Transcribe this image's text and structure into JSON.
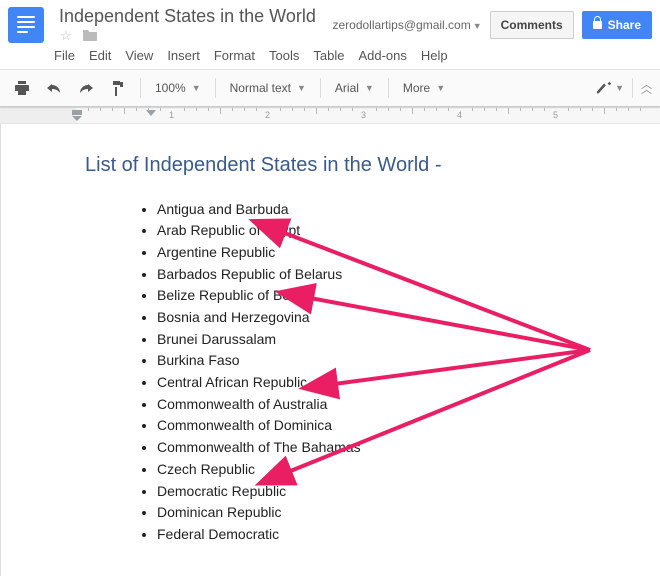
{
  "header": {
    "doc_title": "Independent States in the World",
    "email": "zerodollartips@gmail.com",
    "comments_label": "Comments",
    "share_label": "Share"
  },
  "menu": [
    "File",
    "Edit",
    "View",
    "Insert",
    "Format",
    "Tools",
    "Table",
    "Add-ons",
    "Help"
  ],
  "toolbar": {
    "zoom": "100%",
    "style": "Normal text",
    "font": "Arial",
    "more": "More"
  },
  "document": {
    "heading": "List of Independent States in the World -",
    "items": [
      "Antigua and Barbuda",
      "Arab Republic of Egypt",
      "Argentine Republic",
      "Barbados Republic of Belarus",
      "Belize Republic of Benin",
      "Bosnia and Herzegovina",
      "Brunei Darussalam",
      "Burkina Faso",
      "Central African Republic",
      "Commonwealth of Australia",
      "Commonwealth of Dominica",
      "Commonwealth of The Bahamas",
      "Czech Republic",
      "Democratic Republic",
      "Dominican Republic",
      "Federal Democratic"
    ]
  },
  "ruler_marks": [
    "1",
    "2",
    "3",
    "4",
    "5"
  ]
}
